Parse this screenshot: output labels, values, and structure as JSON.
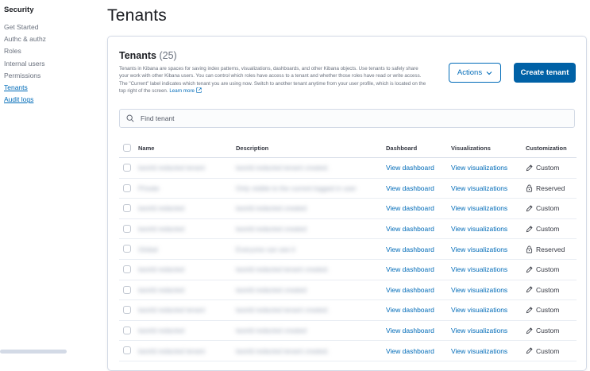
{
  "sidebar": {
    "title": "Security",
    "items": [
      {
        "label": "Get Started",
        "active": false
      },
      {
        "label": "Authc & authz",
        "active": false
      },
      {
        "label": "Roles",
        "active": false
      },
      {
        "label": "Internal users",
        "active": false
      },
      {
        "label": "Permissions",
        "active": false
      },
      {
        "label": "Tenants",
        "active": true
      },
      {
        "label": "Audit logs",
        "active": false
      }
    ]
  },
  "page": {
    "title": "Tenants"
  },
  "panel": {
    "title": "Tenants",
    "count": "(25)",
    "description": "Tenants in Kibana are spaces for saving index patterns, visualizations, dashboards, and other Kibana objects. Use tenants to safely share your work with other Kibana users. You can control which roles have access to a tenant and whether those roles have read or write access. The \"Current\" label indicates which tenant you are using now. Switch to another tenant anytime from your user profile, which is located on the top right of the screen.",
    "learn_more": "Learn more",
    "actions_label": "Actions",
    "create_label": "Create tenant"
  },
  "search": {
    "placeholder": "Find tenant"
  },
  "table": {
    "headers": {
      "name": "Name",
      "description": "Description",
      "dashboard": "Dashboard",
      "visualizations": "Visualizations",
      "customization": "Customization"
    },
    "rows": [
      {
        "name": "tworld redacted tenant",
        "description": "tworld redacted tenant created.",
        "dashboard": "View dashboard",
        "visualizations": "View visualizations",
        "customization": "Custom",
        "icon": "pencil-icon"
      },
      {
        "name": "Private",
        "description": "Only visible to the current logged in user",
        "dashboard": "View dashboard",
        "visualizations": "View visualizations",
        "customization": "Reserved",
        "icon": "lock-icon"
      },
      {
        "name": "tworld redacted",
        "description": "tworld redacted created",
        "dashboard": "View dashboard",
        "visualizations": "View visualizations",
        "customization": "Custom",
        "icon": "pencil-icon"
      },
      {
        "name": "tworld redacted",
        "description": "tworld redacted created",
        "dashboard": "View dashboard",
        "visualizations": "View visualizations",
        "customization": "Custom",
        "icon": "pencil-icon"
      },
      {
        "name": "Global",
        "description": "Everyone can see it",
        "dashboard": "View dashboard",
        "visualizations": "View visualizations",
        "customization": "Reserved",
        "icon": "lock-icon"
      },
      {
        "name": "tworld redacted",
        "description": "tworld redacted tenant created.",
        "dashboard": "View dashboard",
        "visualizations": "View visualizations",
        "customization": "Custom",
        "icon": "pencil-icon"
      },
      {
        "name": "tworld redacted",
        "description": "tworld redacted created",
        "dashboard": "View dashboard",
        "visualizations": "View visualizations",
        "customization": "Custom",
        "icon": "pencil-icon"
      },
      {
        "name": "tworld redacted tenant",
        "description": "tworld redacted tenant created.",
        "dashboard": "View dashboard",
        "visualizations": "View visualizations",
        "customization": "Custom",
        "icon": "pencil-icon"
      },
      {
        "name": "tworld redacted",
        "description": "tworld redacted created",
        "dashboard": "View dashboard",
        "visualizations": "View visualizations",
        "customization": "Custom",
        "icon": "pencil-icon"
      },
      {
        "name": "tworld redacted tenant",
        "description": "tworld redacted tenant created.",
        "dashboard": "View dashboard",
        "visualizations": "View visualizations",
        "customization": "Custom",
        "icon": "pencil-icon"
      }
    ]
  },
  "colors": {
    "accent": "#006bb8",
    "primary_button": "#0061a6",
    "border": "#d3dae6"
  }
}
